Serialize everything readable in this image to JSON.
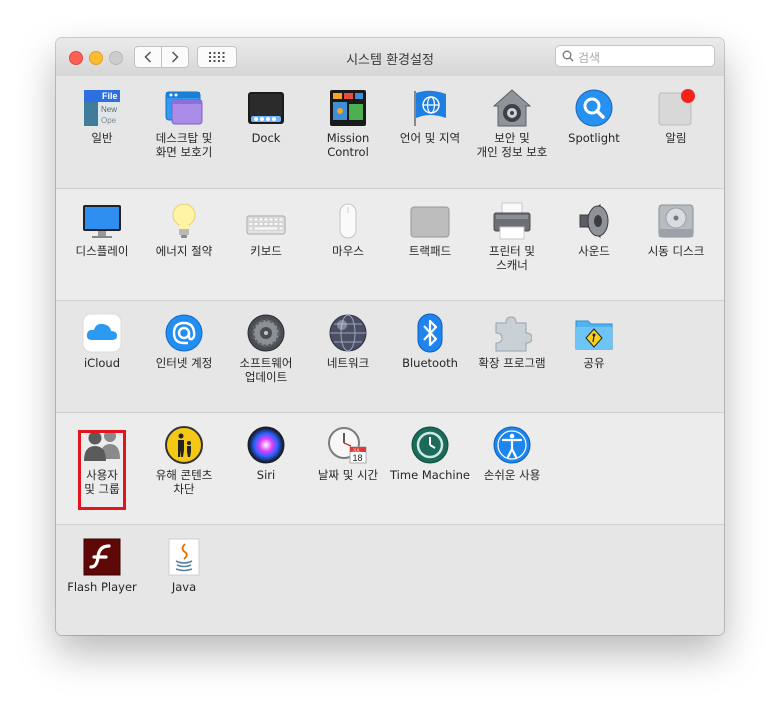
{
  "window": {
    "title": "시스템 환경설정"
  },
  "search": {
    "placeholder": "검색"
  },
  "rows": [
    [
      {
        "label": "일반"
      },
      {
        "label": "데스크탑 및\n화면 보호기"
      },
      {
        "label": "Dock"
      },
      {
        "label": "Mission\nControl"
      },
      {
        "label": "언어 및 지역"
      },
      {
        "label": "보안 및\n개인 정보 보호"
      },
      {
        "label": "Spotlight"
      },
      {
        "label": "알림"
      }
    ],
    [
      {
        "label": "디스플레이"
      },
      {
        "label": "에너지 절약"
      },
      {
        "label": "키보드"
      },
      {
        "label": "마우스"
      },
      {
        "label": "트랙패드"
      },
      {
        "label": "프린터 및\n스캐너"
      },
      {
        "label": "사운드"
      },
      {
        "label": "시동 디스크"
      }
    ],
    [
      {
        "label": "iCloud"
      },
      {
        "label": "인터넷 계정"
      },
      {
        "label": "소프트웨어\n업데이트"
      },
      {
        "label": "네트워크"
      },
      {
        "label": "Bluetooth"
      },
      {
        "label": "확장 프로그램"
      },
      {
        "label": "공유"
      }
    ],
    [
      {
        "label": "사용자\n및 그룹"
      },
      {
        "label": "유해 콘텐츠\n차단"
      },
      {
        "label": "Siri"
      },
      {
        "label": "날짜 및 시간"
      },
      {
        "label": "Time Machine"
      },
      {
        "label": "손쉬운 사용"
      }
    ],
    [
      {
        "label": "Flash Player"
      },
      {
        "label": "Java"
      }
    ]
  ],
  "icon_texts": {
    "general_file": "File",
    "general_new": "New",
    "general_open": "Ope",
    "calendar_month": "JUL",
    "calendar_day": "18"
  },
  "colors": {
    "highlight": "#e3141b",
    "accent": "#1e88e5"
  }
}
